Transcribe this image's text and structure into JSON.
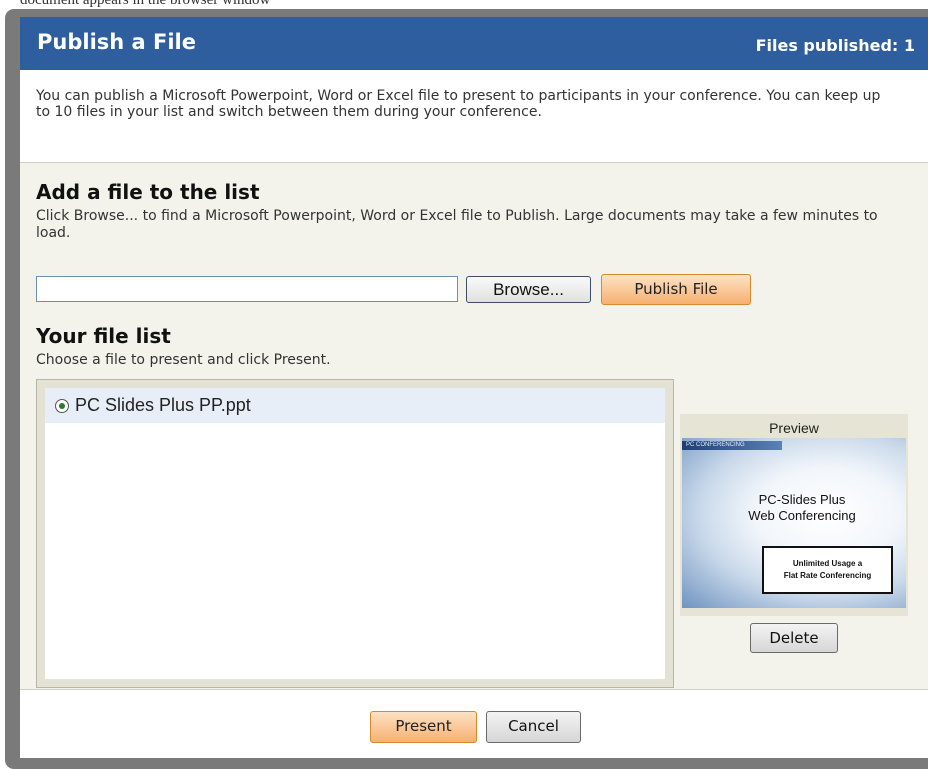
{
  "top_strip_text": "document appears in the browser window",
  "dialog": {
    "title": "Publish a File",
    "files_published": "Files published: 1",
    "intro": "You can publish a Microsoft Powerpoint, Word or Excel file to present to participants in your conference. You can keep up to 10 files in your list and switch between them during your conference."
  },
  "add_section": {
    "heading": "Add a file to the list",
    "description": "Click Browse... to find a Microsoft Powerpoint, Word or Excel file to Publish. Large documents may take a few minutes to load.",
    "file_input_value": "",
    "browse_label": "Browse...",
    "publish_label": "Publish File"
  },
  "list_section": {
    "heading": "Your file list",
    "description": "Choose a file to present and click Present.",
    "files": [
      {
        "name": "PC Slides Plus PP.ppt",
        "selected": true
      }
    ]
  },
  "preview": {
    "label": "Preview",
    "thumb_bar": "PC CONFERENCING",
    "thumb_title_line1": "PC-Slides Plus",
    "thumb_title_line2": "Web Conferencing",
    "thumb_box_line1": "Unlimited Usage a",
    "thumb_box_line2": "Flat Rate Conferencing",
    "delete_label": "Delete"
  },
  "footer": {
    "present_label": "Present",
    "cancel_label": "Cancel"
  },
  "colors": {
    "titlebar": "#2e5e9e",
    "content_bg": "#f3f3ec",
    "primary_button": "#f6b071",
    "selected_row": "#e8eef7"
  },
  "icons": {
    "radio": "radio-selected-icon"
  }
}
